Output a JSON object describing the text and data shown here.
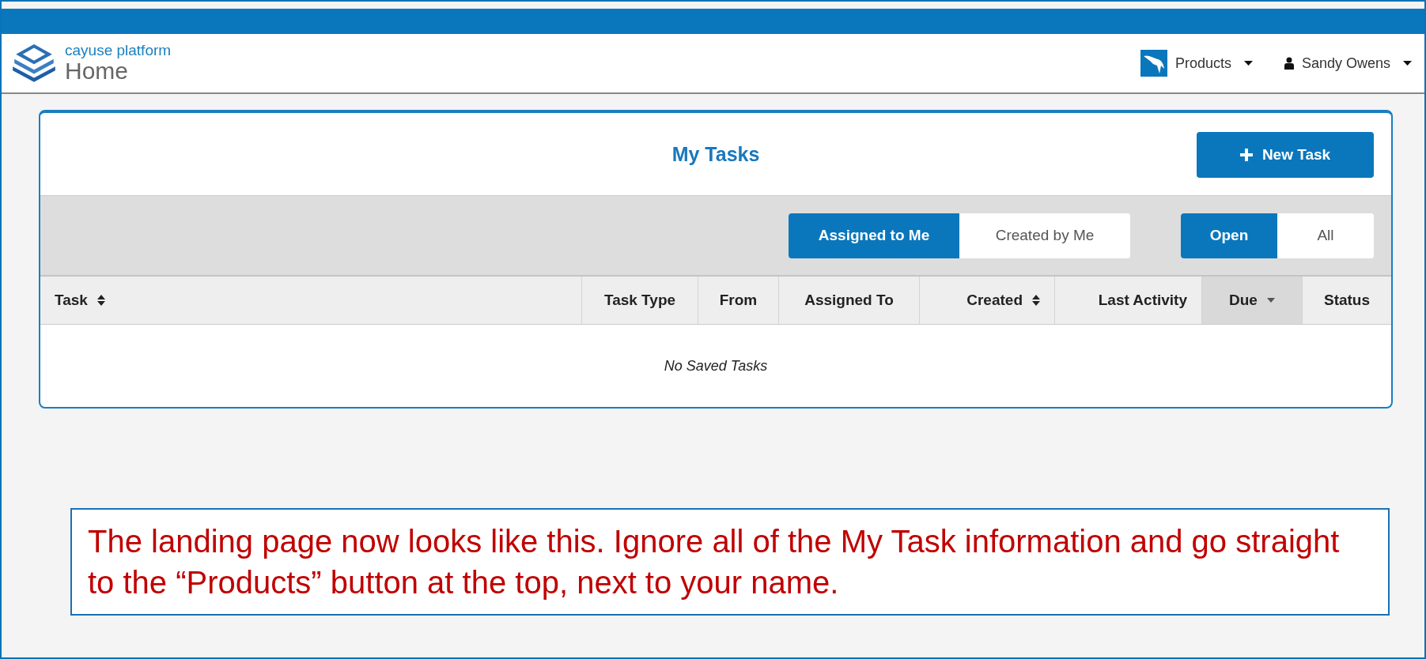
{
  "header": {
    "brand": "cayuse platform",
    "page_title": "Home",
    "menus": [
      {
        "kind": "products",
        "label": "Products"
      },
      {
        "kind": "user",
        "label": "Sandy Owens"
      }
    ]
  },
  "tasks_panel": {
    "title": "My Tasks",
    "new_button": "New Task",
    "filter_groups": [
      [
        {
          "label": "Assigned to Me",
          "selected": true
        },
        {
          "label": "Created by Me",
          "selected": false
        }
      ],
      [
        {
          "label": "Open",
          "selected": true
        },
        {
          "label": "All",
          "selected": false
        }
      ]
    ],
    "table": {
      "columns": [
        {
          "label": "Task",
          "sortable": true,
          "sorted": false
        },
        {
          "label": "Task Type",
          "sortable": false,
          "sorted": false
        },
        {
          "label": "From",
          "sortable": false,
          "sorted": false
        },
        {
          "label": "Assigned To",
          "sortable": false,
          "sorted": false
        },
        {
          "label": "Created",
          "sortable": true,
          "sorted": false
        },
        {
          "label": "Last Activity",
          "sortable": false,
          "sorted": false
        },
        {
          "label": "Due",
          "sortable": true,
          "sorted": true
        },
        {
          "label": "Status",
          "sortable": false,
          "sorted": false
        }
      ],
      "empty_message": "No Saved Tasks"
    }
  },
  "callout": {
    "text": "The landing page now looks like this. Ignore all of the My Task information and go straight to the “Products” button at the top, next to your name."
  }
}
